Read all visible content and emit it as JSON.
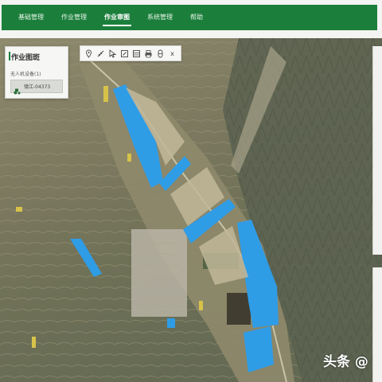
{
  "nav": {
    "items": [
      {
        "label": "基础管理",
        "active": false
      },
      {
        "label": "作业管理",
        "active": false
      },
      {
        "label": "作业审图",
        "active": true
      },
      {
        "label": "系统管理",
        "active": false
      },
      {
        "label": "帮助",
        "active": false
      }
    ]
  },
  "panel": {
    "title": "作业图斑",
    "subtitle": "无人机设备(1)",
    "device": {
      "label": "镇江-04373",
      "icon": "tractor-icon"
    }
  },
  "toolbar": {
    "tools": [
      "location-pin-icon",
      "measure-icon",
      "select-icon",
      "edit-icon",
      "layers-icon",
      "print-icon",
      "capsule-icon",
      "close-icon"
    ],
    "close_label": "x"
  },
  "watermark": {
    "text": "头条 @"
  },
  "colors": {
    "nav_green": "#1b7f3b",
    "field_blue": "#2f9ce6",
    "panel_bg": "#f6f6f4"
  }
}
